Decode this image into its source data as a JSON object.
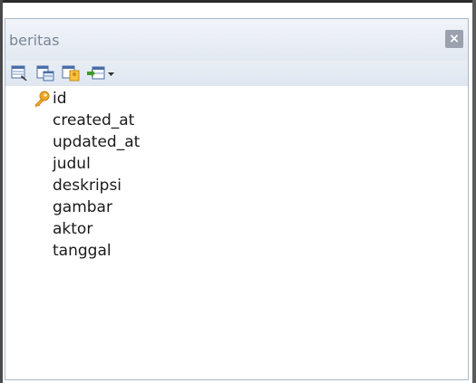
{
  "window": {
    "title": "beritas",
    "close_label": "×"
  },
  "toolbar": {
    "icons": [
      "table-properties-icon",
      "table-data-icon",
      "key-properties-icon",
      "insert-field-icon"
    ]
  },
  "fields": [
    {
      "name": "id",
      "primary_key": true
    },
    {
      "name": "created_at",
      "primary_key": false
    },
    {
      "name": "updated_at",
      "primary_key": false
    },
    {
      "name": "judul",
      "primary_key": false
    },
    {
      "name": "deskripsi",
      "primary_key": false
    },
    {
      "name": "gambar",
      "primary_key": false
    },
    {
      "name": "aktor",
      "primary_key": false
    },
    {
      "name": "tanggal",
      "primary_key": false
    }
  ],
  "colors": {
    "titlebar": "#e9eef5",
    "title_text": "#7a8796",
    "close_button": "#9aa3ad",
    "key": "#f0a82a"
  }
}
